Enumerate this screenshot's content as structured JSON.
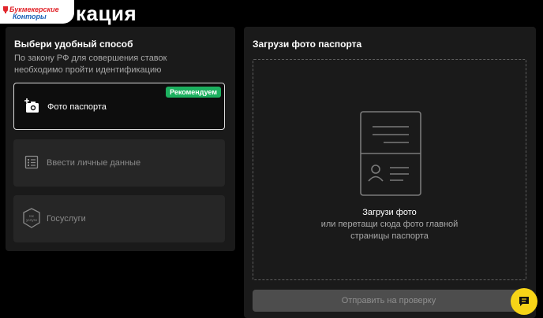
{
  "logo": {
    "line1": "Букмекерские",
    "line2": "Конторы"
  },
  "page": {
    "title": "кация"
  },
  "left": {
    "title": "Выбери удобный способ",
    "hint": "По закону РФ для совершения ставок необходимо пройти идентификацию",
    "options": [
      {
        "label": "Фото паспорта",
        "icon": "camera-plus-icon",
        "badge": "Рекомендуем",
        "state": "selected"
      },
      {
        "label": "Ввести личные данные",
        "icon": "form-list-icon",
        "state": "disabled"
      },
      {
        "label": "Госуслуги",
        "icon": "gosuslugi-icon",
        "icon_text": "гос услуги",
        "state": "disabled"
      }
    ]
  },
  "right": {
    "title": "Загрузи фото паспорта",
    "drop_title": "Загрузи фото",
    "drop_hint": "или перетащи сюда фото главной страницы паспорта",
    "submit_label": "Отправить на проверку"
  },
  "colors": {
    "accent_green": "#1cb05f",
    "chat_yellow": "#f7d417",
    "panel": "#1a1a1a"
  },
  "chat": {
    "icon": "chat-icon"
  }
}
